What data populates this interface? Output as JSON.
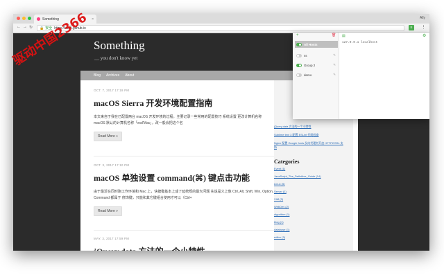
{
  "browser": {
    "tab_title": "Something",
    "tab_close": "×",
    "profile_name": "Ally",
    "nav_back": "←",
    "nav_forward": "→",
    "nav_reload": "↻",
    "secure_label": "安全",
    "url": "https://ksofi.github.io",
    "ext_badge": "≡",
    "menu": "⋮",
    "colors": {
      "close": "#ff5f57",
      "minimize": "#febc2e",
      "zoom": "#28c840"
    }
  },
  "site": {
    "title": "Something",
    "subtitle": "__ you don't know yet",
    "nav": [
      "Blog",
      "Archives",
      "About"
    ]
  },
  "posts": [
    {
      "date": "OCT. 7, 2017 17:19 PM",
      "title": "macOS Sierra 开发环境配置指南",
      "excerpt": "本文来自于我在已配置两台 macOS 开发环境的过程。主要记录一些常用的配置技巧 系统设置 更改计算机名称 macOS 默认的计算机名称「xxd'Mac」，改一般会把这个名",
      "read_more": "Read More »"
    },
    {
      "date": "OCT. 3, 2017 17:10 PM",
      "title": "macOS 单独设置 command(⌘) 键点击功能",
      "excerpt": "由于最近在同时跑工作环境和 Mac 上，快捷键基本上成了延统规的最大问题 先说是义上像 Ctrl, Alt, Shift, Win, Option, Command 都属于 修饰键，只能和其它键组合使用才可以（Ctrl+",
      "read_more": "Read More »"
    },
    {
      "date": "MAY. 3, 2017 17:59 PM",
      "title": "jQuery.data 方法的一个小特性"
    }
  ],
  "sidebar": {
    "recent": [
      "jQuery.data 方法的一个小特性",
      "Sublime text 3 配置 ESLint 代码检查",
      "Nginx 配置 Google fonts 反向代理并开启 HTTP2/SSL 支持"
    ],
    "categories_title": "Categories",
    "categories": [
      "Event (1)",
      "JavaScript_The_Definitive_Guide (14)",
      "Linux (5)",
      "Server (1)",
      "VIM (3)",
      "WebDev (2)",
      "algorithm (1)",
      "blog (1)",
      "database (1)",
      "editor (3)"
    ]
  },
  "popup": {
    "add": "+",
    "delete": "🗑",
    "doc": "▤",
    "settings": "⚙",
    "edit": "✎",
    "hosts": [
      {
        "label": "All Hosts",
        "enabled": true,
        "active": true
      },
      {
        "label": "ss",
        "enabled": false,
        "active": false
      },
      {
        "label": "Group 2",
        "enabled": true,
        "active": false
      },
      {
        "label": "demo",
        "enabled": false,
        "active": false
      }
    ],
    "host_content": "127.0.0.1 localhost"
  },
  "watermark": "驱动中国2366"
}
